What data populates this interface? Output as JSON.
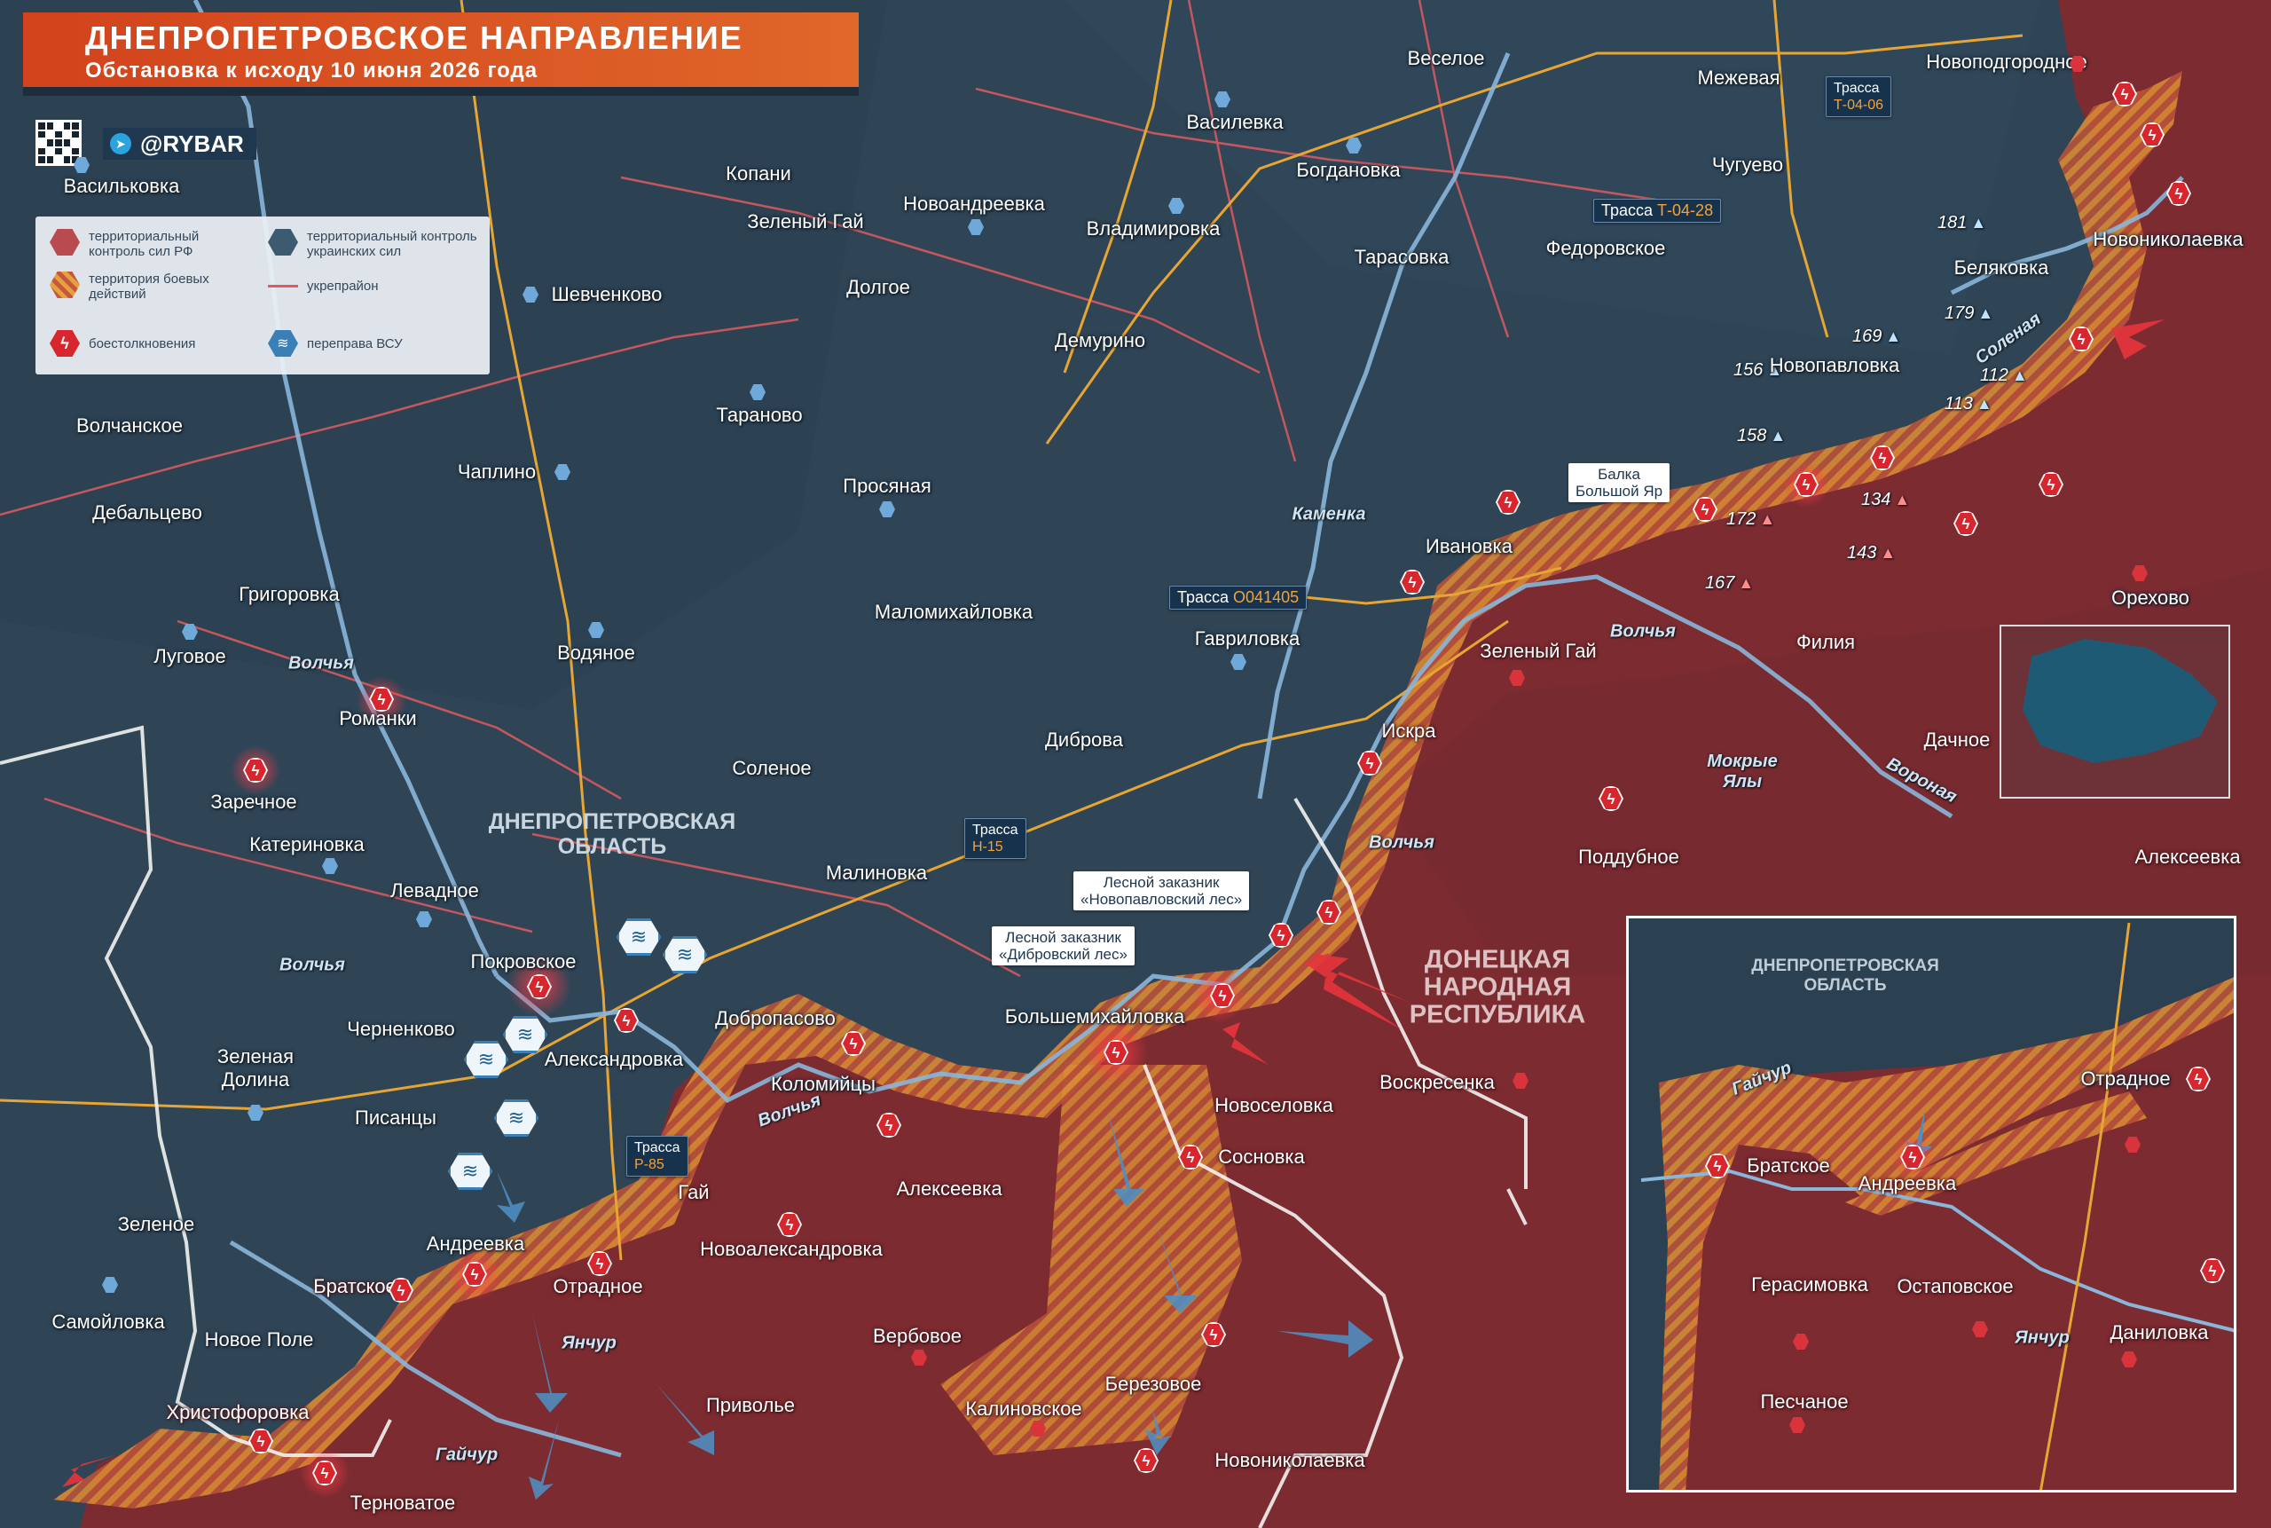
{
  "header": {
    "title": "ДНЕПРОПЕТРОВСКОЕ НАПРАВЛЕНИЕ",
    "subtitle": "Обстановка к исходу 10 июня 2026 года",
    "brand": "@RYBAR"
  },
  "legend": {
    "ru_control": "территориальный контроль сил РФ",
    "ua_control": "территориальный контроль украинских сил",
    "combat": "территория боевых действий",
    "fortified": "укрепрайон",
    "clashes": "боестолкновения",
    "crossing": "переправа ВСУ"
  },
  "colors": {
    "ua_territory": "#2d4253",
    "ru_territory": "#7c2b31",
    "combat_zone": "#e09a3a",
    "clash_marker": "#d7262e",
    "ua_marker": "#6fa9da",
    "roads": "#e7a533",
    "fortified_line": "#e05a5f",
    "rivers": "#8ab6da"
  },
  "regions": {
    "dnepr": "ДНЕПРОПЕТРОВСКАЯ\nОБЛАСТЬ",
    "dnr": "ДОНЕЦКАЯ\nНАРОДНАЯ\nРЕСПУБЛИКА",
    "inset_dnepr": "ДНЕПРОПЕТРОВСКАЯ\nОБЛАСТЬ"
  },
  "rivers": [
    "Волчья",
    "Волчья",
    "Волчья",
    "Волчья",
    "Волчья",
    "Каменка",
    "Мокрые\nЯлы",
    "Соленая",
    "Вороная",
    "Янчур",
    "Гайчур",
    "Гайчур",
    "Янчур"
  ],
  "roads": {
    "t0406_label": "Трасса",
    "t0406_code": "Т-04-06",
    "t0428_label": "Трасса",
    "t0428_code": "Т-04-28",
    "o041405_label": "Трасса",
    "o041405_code": "О041405",
    "h15_label": "Трасса",
    "h15_code": "Н-15",
    "p85_label": "Трасса",
    "p85_code": "Р-85"
  },
  "reserves": {
    "balka": "Балка\nБольшой Яр",
    "novopavlovsky": "Лесной заказник\n«Новопавловский лес»",
    "dibrovsky": "Лесной заказник\n«Дибровский лес»"
  },
  "heights": {
    "h181": "181",
    "h169": "169",
    "h179": "179",
    "h156": "156",
    "h112": "112",
    "h158": "158",
    "h113": "113",
    "h134": "134",
    "h172": "172",
    "h143": "143",
    "h167": "167"
  },
  "settlements": {
    "vasilkovka": "Васильковка",
    "vesel": "Веселое",
    "mezhevaya": "Межевая",
    "novopodgorodnoe": "Новоподгородное",
    "vasilevka": "Василевка",
    "kopani": "Копани",
    "bogdanovka": "Богдановка",
    "chuguevo": "Чугуево",
    "zeleny_gai_n": "Зеленый Гай",
    "novoandreevka": "Новоандреевка",
    "vladimirovka": "Владимировка",
    "novonikolaevka_ne": "Новониколаевка",
    "shevchenkovo": "Шевченково",
    "dolgoe": "Долгое",
    "tarasovka": "Тарасовка",
    "fedorovskoe": "Федоровское",
    "belyakovka": "Беляковка",
    "demurino": "Демурино",
    "novopavlovka": "Новопавловка",
    "taranovo": "Тараново",
    "volchanskoe": "Волчанское",
    "chaplino": "Чаплино",
    "prosyanaya": "Просяная",
    "debaltsevo": "Дебальцево",
    "ivanovka": "Ивановка",
    "grigorovka": "Григоровка",
    "orekhovo": "Орехово",
    "malomikhailovka": "Маломихайловка",
    "vodyanoe": "Водяное",
    "gavrilovka": "Гавриловка",
    "zeleny_gai_s": "Зеленый Гай",
    "filiya": "Филия",
    "lugovoe": "Луговое",
    "romanki": "Романки",
    "iskra": "Искра",
    "dibrova": "Диброва",
    "dachnoe": "Дачное",
    "zarechnoe": "Заречное",
    "solenoe": "Соленое",
    "katerinovka": "Катериновка",
    "alekseevka_e": "Алексеевка",
    "poddubnoe": "Поддубное",
    "malinovka": "Малиновка",
    "levadnoe": "Левадное",
    "pokrovskoe": "Покровское",
    "dobropasovo": "Добропасово",
    "bolshemikhailovka": "Большемихайловка",
    "chernenkovo": "Черненково",
    "aleksandrovka": "Александровка",
    "zelenaya_dolina": "Зеленая\nДолина",
    "kolomiytsy": "Коломийцы",
    "voskresenka": "Воскресенка",
    "novoselovka": "Новоселовка",
    "pisantsy": "Писанцы",
    "sosnovka": "Сосновка",
    "gai": "Гай",
    "alekseevka_s": "Алексеевка",
    "zelenoe": "Зеленое",
    "andreevka": "Андреевка",
    "novoaleksandrovka": "Новоалександровка",
    "bratskoe": "Братское",
    "otradnoe": "Отрадное",
    "samoilovka": "Самойловка",
    "novoe_pole": "Новое Поле",
    "verbovoe": "Вербовое",
    "berezovoe": "Березовое",
    "khristoforovka": "Христофоровка",
    "privolye": "Приволье",
    "kalinovskoe": "Калиновское",
    "novonikolaevka_s": "Новониколаевка",
    "ternovatoe": "Терноватое"
  },
  "inset_settlements": {
    "otradnoe": "Отрадное",
    "bratskoe": "Братское",
    "andreevka": "Андреевка",
    "gerasimovka": "Герасимовка",
    "ostapovskoe": "Остаповское",
    "danilovka": "Даниловка",
    "peschanoe": "Песчаное"
  }
}
